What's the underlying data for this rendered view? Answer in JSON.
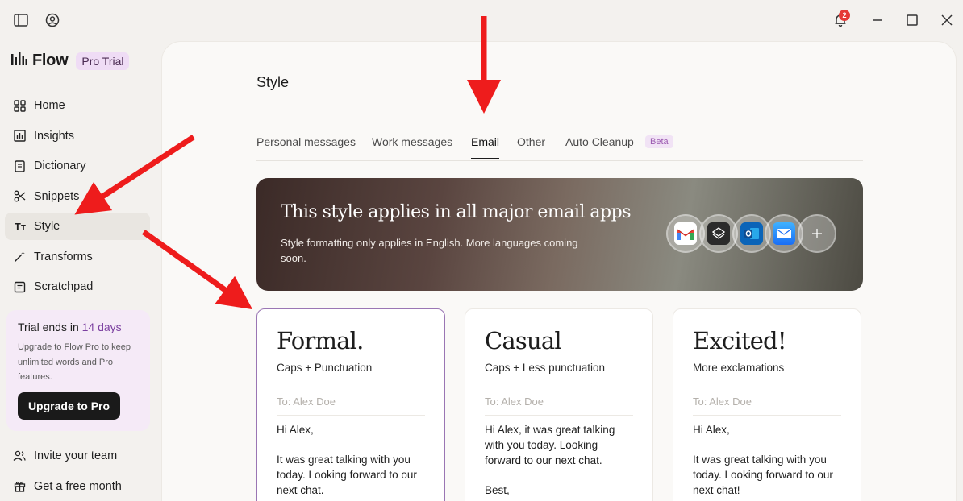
{
  "app": {
    "name": "Flow",
    "plan_badge": "Pro Trial"
  },
  "titlebar": {
    "notification_count": "2"
  },
  "sidebar": {
    "items": [
      {
        "label": "Home",
        "icon": "grid-icon"
      },
      {
        "label": "Insights",
        "icon": "bar-chart-icon"
      },
      {
        "label": "Dictionary",
        "icon": "book-icon"
      },
      {
        "label": "Snippets",
        "icon": "scissors-icon"
      },
      {
        "label": "Style",
        "icon": "text-style-icon",
        "active": true
      },
      {
        "label": "Transforms",
        "icon": "magic-wand-icon"
      },
      {
        "label": "Scratchpad",
        "icon": "notepad-icon"
      }
    ],
    "trial": {
      "title_prefix": "Trial ends in ",
      "days": "14 days",
      "description": "Upgrade to Flow Pro to keep unlimited words and Pro features.",
      "button": "Upgrade to Pro"
    },
    "bottom_items": [
      {
        "label": "Invite your team",
        "icon": "users-icon"
      },
      {
        "label": "Get a free month",
        "icon": "gift-icon"
      }
    ]
  },
  "main": {
    "title": "Style",
    "tabs": [
      {
        "label": "Personal messages"
      },
      {
        "label": "Work messages"
      },
      {
        "label": "Email",
        "active": true
      },
      {
        "label": "Other"
      },
      {
        "label": "Auto Cleanup"
      }
    ],
    "beta_label": "Beta",
    "banner": {
      "title": "This style applies in all major email apps",
      "subtitle": "Style formatting only applies in English. More languages coming soon."
    },
    "cards": [
      {
        "title": "Formal.",
        "subtitle": "Caps + Punctuation",
        "to": "To: Alex Doe",
        "body": [
          "Hi Alex,",
          "It was great talking with you today. Looking forward to our next chat."
        ]
      },
      {
        "title": "Casual",
        "subtitle": "Caps + Less punctuation",
        "to": "To: Alex Doe",
        "body": [
          "Hi Alex, it was great talking with you today. Looking forward to our next chat.",
          "Best,"
        ]
      },
      {
        "title": "Excited!",
        "subtitle": "More exclamations",
        "to": "To: Alex Doe",
        "body": [
          "Hi Alex,",
          "It was great talking with you today. Looking forward to our next chat!"
        ]
      }
    ]
  },
  "colors": {
    "accent": "#7b3fa0",
    "arrow": "#ee1c1c",
    "badge": "#e53935"
  }
}
